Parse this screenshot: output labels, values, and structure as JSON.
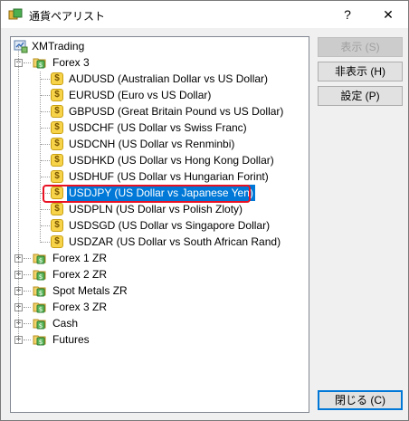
{
  "window": {
    "title": "通貨ペアリスト",
    "help_label": "?",
    "close_label": "✕"
  },
  "buttons": {
    "show": "表示 (S)",
    "hide": "非表示 (H)",
    "settings": "設定 (P)",
    "close": "閉じる (C)"
  },
  "tree": {
    "root": "XMTrading",
    "forex3": "Forex 3",
    "symbols": [
      "AUDUSD  (Australian Dollar vs US Dollar)",
      "EURUSD  (Euro vs US Dollar)",
      "GBPUSD  (Great Britain Pound vs US Dollar)",
      "USDCHF  (US Dollar vs Swiss Franc)",
      "USDCNH  (US Dollar vs Renminbi)",
      "USDHKD  (US Dollar vs Hong Kong Dollar)",
      "USDHUF  (US Dollar vs Hungarian Forint)",
      "USDJPY  (US Dollar vs Japanese Yen)",
      "USDPLN  (US Dollar vs Polish Zloty)",
      "USDSGD  (US Dollar vs Singapore Dollar)",
      "USDZAR  (US Dollar vs South African Rand)"
    ],
    "groups": [
      "Forex 1 ZR",
      "Forex 2 ZR",
      "Spot Metals ZR",
      "Forex 3 ZR",
      "Cash",
      "Futures"
    ],
    "symbol_glyph": "$",
    "expanded_glyph": "−",
    "collapsed_glyph": "+"
  }
}
